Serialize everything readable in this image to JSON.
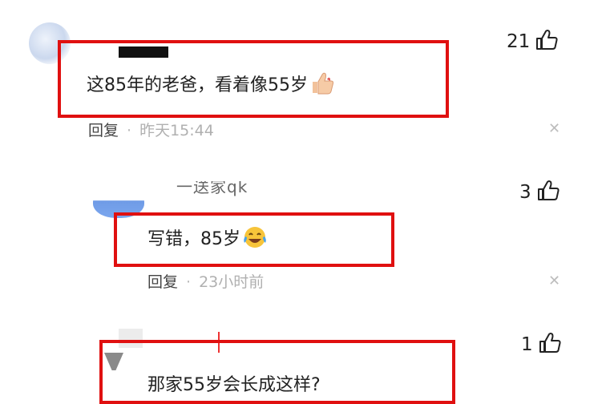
{
  "comments": [
    {
      "text": "这85年的老爸，看着像55岁",
      "emoji_icon": "thumbs-up-icon",
      "reply_label": "回复",
      "separator": "·",
      "time": "昨天15:44",
      "likes": "21"
    },
    {
      "username": "一送家qk",
      "text": "写错，85岁",
      "emoji_icon": "laughing-crying-icon",
      "reply_label": "回复",
      "separator": "·",
      "time": "23小时前",
      "likes": "3"
    },
    {
      "text": "那家55岁会长成这样?",
      "likes": "1"
    }
  ],
  "colors": {
    "highlight_box": "#e01010",
    "timestamp": "#b0b0b0",
    "avatar_blue": "#7aa0e6"
  }
}
